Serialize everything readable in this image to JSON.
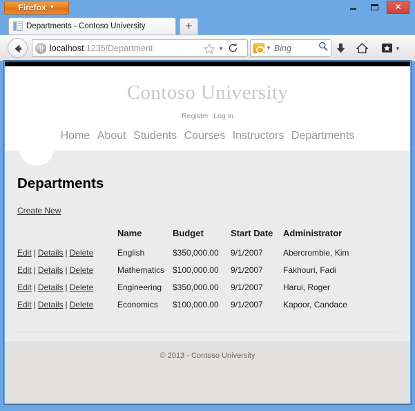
{
  "window": {
    "firefox_button_label": "Firefox",
    "firefox_caret": "▼",
    "minimize_title": "Minimize",
    "maximize_title": "Maximize",
    "close_label": "✕"
  },
  "tabs": {
    "active_title": "Departments - Contoso University",
    "new_tab_label": "+"
  },
  "toolbar": {
    "url_host": "localhost",
    "url_path": ":1235/Department",
    "search_placeholder": "Bing",
    "engine_caret": "▼",
    "star_caret": "▼",
    "bookmarks_caret": "▼"
  },
  "site": {
    "brand": "Contoso University",
    "account_links": [
      {
        "label": "Register"
      },
      {
        "label": "Log in"
      }
    ],
    "nav": [
      {
        "label": "Home"
      },
      {
        "label": "About"
      },
      {
        "label": "Students"
      },
      {
        "label": "Courses"
      },
      {
        "label": "Instructors"
      },
      {
        "label": "Departments"
      }
    ],
    "footer": "© 2013 - Contoso University"
  },
  "main": {
    "page_title": "Departments",
    "create_new_label": "Create New",
    "table": {
      "columns": [
        "",
        "Name",
        "Budget",
        "Start Date",
        "Administrator"
      ],
      "actions": {
        "edit": "Edit",
        "details": "Details",
        "delete": "Delete",
        "separator": "|"
      },
      "rows": [
        {
          "name": "English",
          "budget": "$350,000.00",
          "start_date": "9/1/2007",
          "administrator": "Abercrombie, Kim"
        },
        {
          "name": "Mathematics",
          "budget": "$100,000.00",
          "start_date": "9/1/2007",
          "administrator": "Fakhouri, Fadi"
        },
        {
          "name": "Engineering",
          "budget": "$350,000.00",
          "start_date": "9/1/2007",
          "administrator": "Harui, Roger"
        },
        {
          "name": "Economics",
          "budget": "$100,000.00",
          "start_date": "9/1/2007",
          "administrator": "Kapoor, Candace"
        }
      ]
    }
  },
  "colors": {
    "chrome_blue": "#6ea8e4",
    "firefox_orange": "#e8812a",
    "close_red": "#c9433c",
    "page_gray": "#ebebeb",
    "footer_gray": "#e3e1df",
    "brand_gray": "#c8c8c8"
  }
}
